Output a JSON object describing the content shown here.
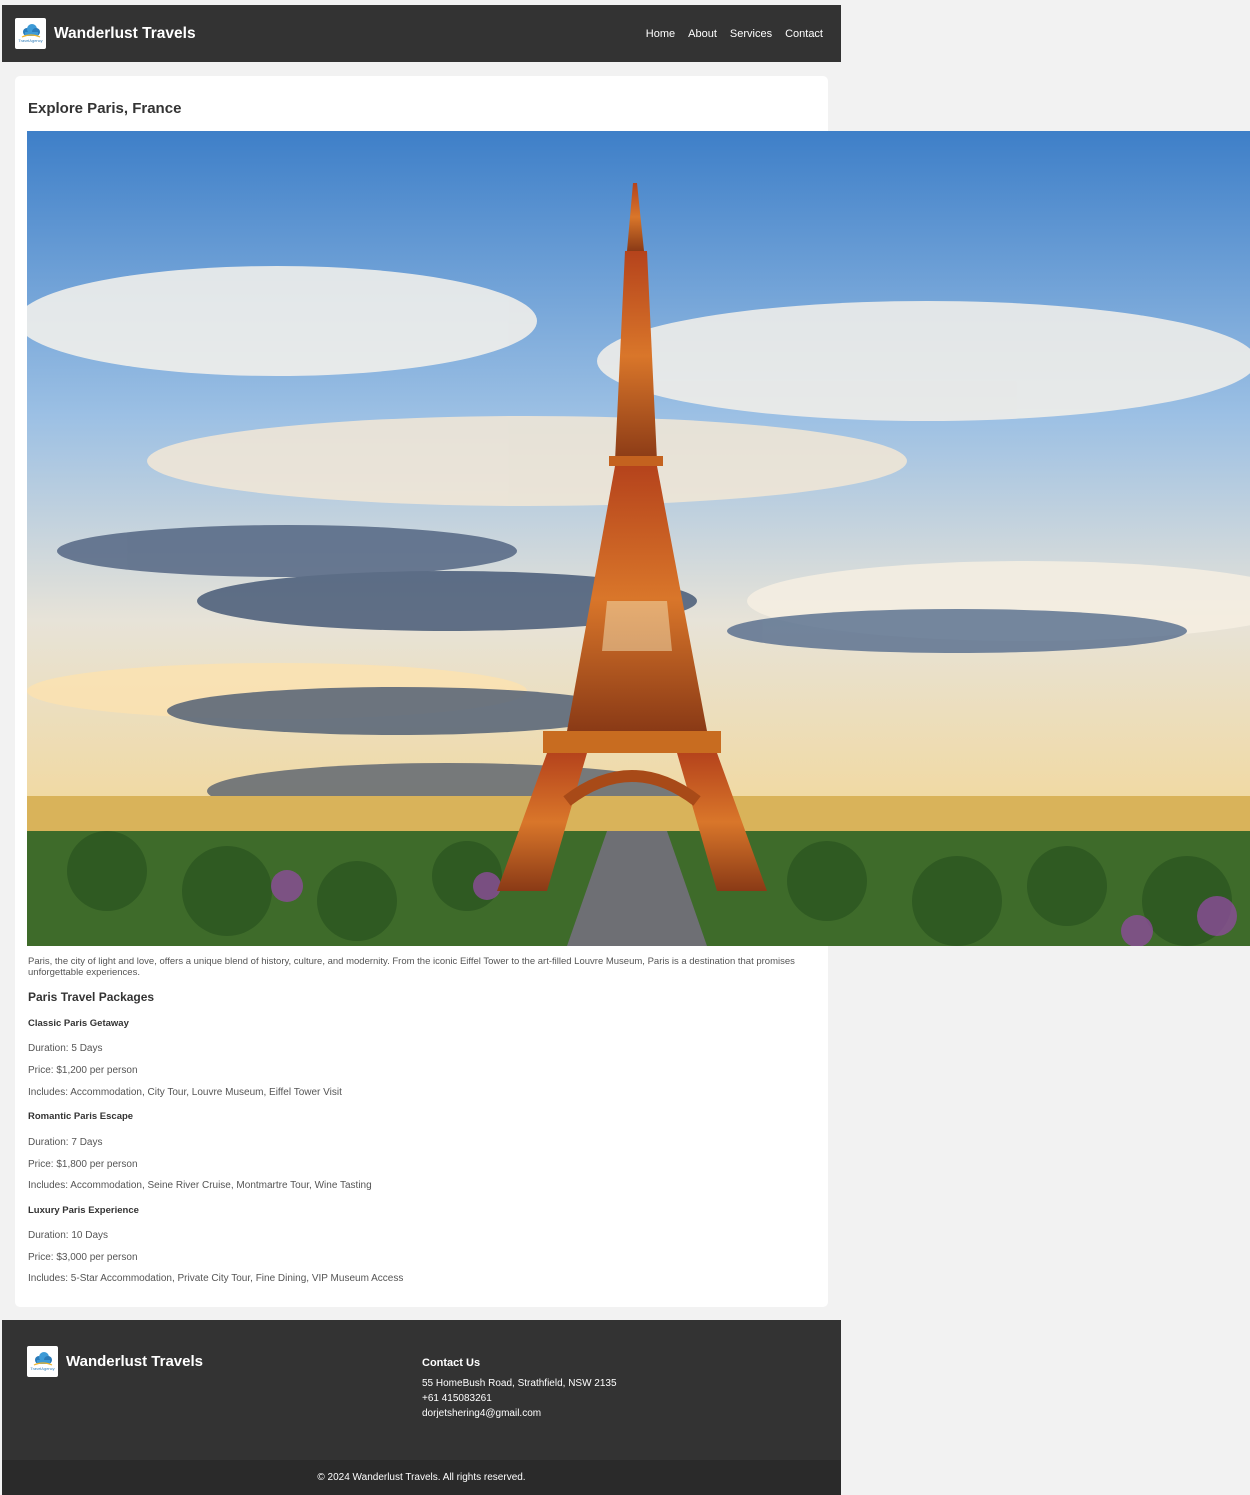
{
  "brand": {
    "name": "Wanderlust Travels",
    "logo_text": "TravelAgency",
    "logo_icon": "cloud-logo-icon"
  },
  "nav": {
    "items": [
      "Home",
      "About",
      "Services",
      "Contact"
    ]
  },
  "main": {
    "title": "Explore Paris, France",
    "intro": "Paris, the city of light and love, offers a unique blend of history, culture, and modernity. From the iconic Eiffel Tower to the art-filled Louvre Museum, Paris is a destination that promises unforgettable experiences.",
    "packages_title": "Paris Travel Packages",
    "packages": [
      {
        "name": "Classic Paris Getaway",
        "duration": "Duration: 5 Days",
        "price": "Price: $1,200 per person",
        "includes": "Includes: Accommodation, City Tour, Louvre Museum, Eiffel Tower Visit"
      },
      {
        "name": "Romantic Paris Escape",
        "duration": "Duration: 7 Days",
        "price": "Price: $1,800 per person",
        "includes": "Includes: Accommodation, Seine River Cruise, Montmartre Tour, Wine Tasting"
      },
      {
        "name": "Luxury Paris Experience",
        "duration": "Duration: 10 Days",
        "price": "Price: $3,000 per person",
        "includes": "Includes: 5-Star Accommodation, Private City Tour, Fine Dining, VIP Museum Access"
      }
    ]
  },
  "footer": {
    "contact_title": "Contact Us",
    "address": "55 HomeBush Road, Strathfield, NSW 2135",
    "phone": "+61 415083261",
    "email": "dorjetshering4@gmail.com",
    "copyright": "© 2024 Wanderlust Travels. All rights reserved."
  },
  "colors": {
    "header_bg": "#333333",
    "page_bg": "#f2f2f2",
    "card_bg": "#ffffff",
    "copyright_bg": "#2a2a2a",
    "logo_blue": "#2b7bb9"
  }
}
